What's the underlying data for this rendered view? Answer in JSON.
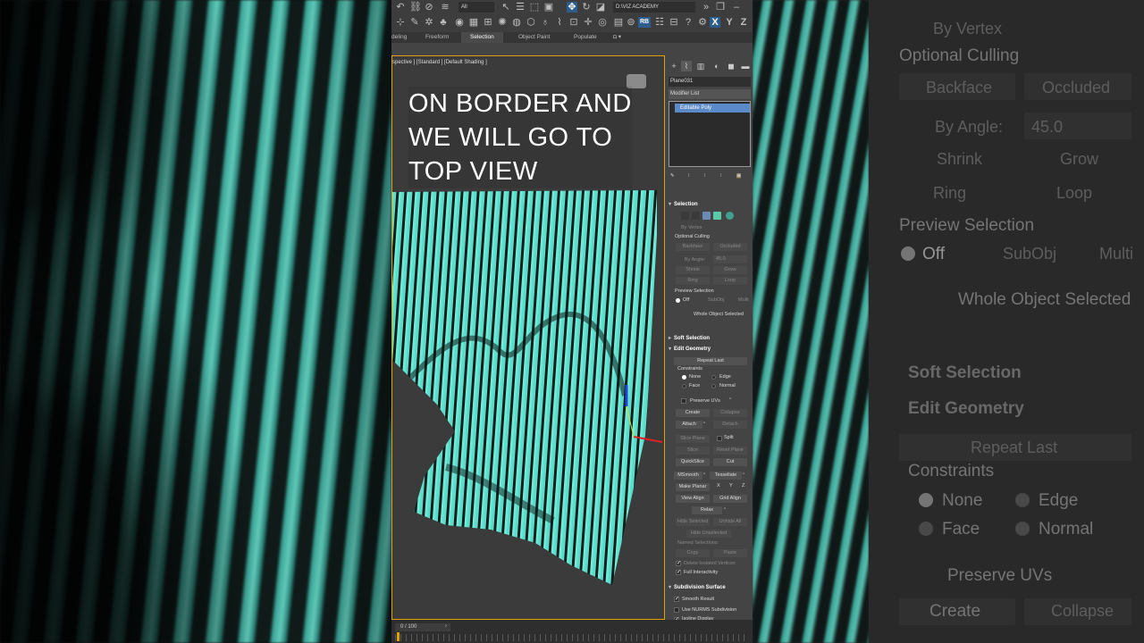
{
  "toolbar": {
    "all_filter": "All",
    "workspace": "D:\\VIZ ACADEMY",
    "axis_labels": [
      "X",
      "Y",
      "Z"
    ],
    "rb_label": "RB"
  },
  "ribbon": {
    "tabs": [
      "deling",
      "Freeform",
      "Selection",
      "Object Paint",
      "Populate"
    ]
  },
  "viewport": {
    "label": "spective ] [Standard ] [Default Shading ]",
    "caption_lines": [
      "ON BORDER AND",
      "WE WILL GO TO",
      "TOP VIEW"
    ],
    "accent_color": "#62e8d6"
  },
  "timeline": {
    "frame": "0 / 100"
  },
  "command_panel": {
    "object_name": "Plane031",
    "modifier_list": "Modifier List",
    "stack_item": "Editable Poly",
    "selection": {
      "title": "Selection",
      "by_vertex": "By Vertex",
      "optional_culling": "Optional Culling",
      "backface": "Backface",
      "occluded": "Occluded",
      "by_angle": "By Angle:",
      "angle_value": "45.0",
      "shrink": "Shrink",
      "grow": "Grow",
      "ring": "Ring",
      "loop": "Loop",
      "preview_selection": "Preview Selection",
      "preview_opts": [
        "Off",
        "SubObj",
        "Multi"
      ],
      "status": "Whole Object Selected"
    },
    "soft_selection": "Soft Selection",
    "edit_geometry": {
      "title": "Edit Geometry",
      "repeat_last": "Repeat Last",
      "constraints": "Constraints",
      "none": "None",
      "edge": "Edge",
      "face": "Face",
      "normal": "Normal",
      "preserve_uvs": "Preserve UVs",
      "create": "Create",
      "collapse": "Collapse",
      "attach": "Attach",
      "detach": "Detach",
      "slice_plane": "Slice Plane",
      "split": "Split",
      "slice": "Slice",
      "reset_plane": "Reset Plane",
      "quickslice": "QuickSlice",
      "cut": "Cut",
      "msmooth": "MSmooth",
      "tessellate": "Tessellate",
      "make_planar": "Make Planar",
      "x": "X",
      "y": "Y",
      "z": "Z",
      "view_align": "View Align",
      "grid_align": "Grid Align",
      "relax": "Relax",
      "hide_selected": "Hide Selected",
      "unhide_all": "Unhide All",
      "hide_unselected": "Hide Unselected",
      "named_selections": "Named Selections:",
      "copy": "Copy",
      "paste": "Paste",
      "delete_isolated": "Delete Isolated Vertices",
      "full_interactivity": "Full Interactivity"
    },
    "subdivision": {
      "title": "Subdivision Surface",
      "smooth_result": "Smooth Result",
      "use_nurms": "Use NURMS Subdivision",
      "isoline": "Isoline Display"
    }
  },
  "background_ghost": {
    "by_vertex": "By Vertex",
    "optional_culling": "Optional Culling",
    "backface": "Backface",
    "occluded": "Occluded",
    "by_angle": "By Angle:",
    "angle_value": "45.0",
    "shrink": "Shrink",
    "grow": "Grow",
    "ring": "Ring",
    "loop": "Loop",
    "preview_selection": "Preview Selection",
    "off": "Off",
    "subobj": "SubObj",
    "multi": "Multi",
    "whole_object": "Whole Object Selected",
    "soft_selection": "Soft Selection",
    "edit_geometry": "Edit Geometry",
    "repeat_last": "Repeat Last",
    "constraints": "Constraints",
    "none": "None",
    "edge": "Edge",
    "face": "Face",
    "normal": "Normal",
    "preserve_uvs": "Preserve UVs",
    "create": "Create",
    "collapse": "Collapse"
  }
}
